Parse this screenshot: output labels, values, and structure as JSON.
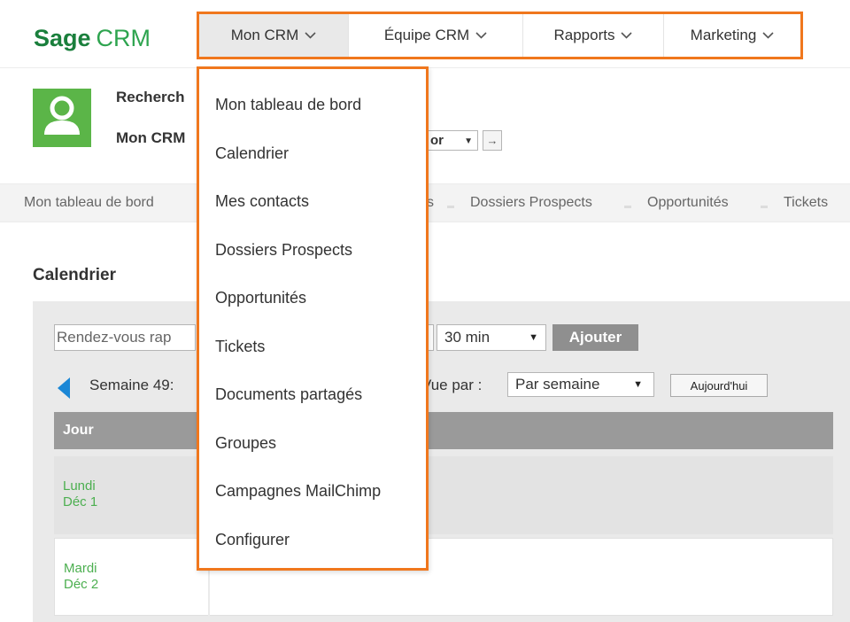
{
  "app": {
    "brand_sage": "Sage",
    "brand_crm": "CRM"
  },
  "topnav": {
    "items": [
      {
        "label": "Mon CRM",
        "active": true
      },
      {
        "label": "Équipe CRM",
        "active": false
      },
      {
        "label": "Rapports",
        "active": false
      },
      {
        "label": "Marketing",
        "active": false
      }
    ]
  },
  "header": {
    "line1": "Recherch",
    "line2": "Mon CRM",
    "select_value": "or",
    "go_icon": "arrow-right-icon"
  },
  "subnav": {
    "items": [
      "Mon tableau de bord",
      "s",
      "Dossiers Prospects",
      "Opportunités",
      "Tickets"
    ]
  },
  "section_title": "Calendrier",
  "calendar": {
    "appointment_placeholder": "Rendez-vous rap",
    "duration_value": "30 min",
    "add_button": "Ajouter",
    "week_label": "Semaine 49:",
    "view_by_label": "Vue par :",
    "view_value": "Par semaine",
    "today_button": "Aujourd'hui",
    "column_header": "Jour",
    "days": [
      {
        "name": "Lundi",
        "date": "Déc 1"
      },
      {
        "name": "Mardi",
        "date": "Déc 2"
      }
    ]
  },
  "dropdown": {
    "items": [
      "Mon tableau de bord",
      "Calendrier",
      "Mes contacts",
      "Dossiers Prospects",
      "Opportunités",
      "Tickets",
      "Documents partagés",
      "Groupes",
      "Campagnes MailChimp",
      "Configurer"
    ]
  },
  "colors": {
    "highlight": "#f0771d",
    "brand_dark": "#1a7f3c",
    "brand_light": "#2ea44f",
    "avatar": "#5bb548",
    "day_text": "#4caf50"
  }
}
